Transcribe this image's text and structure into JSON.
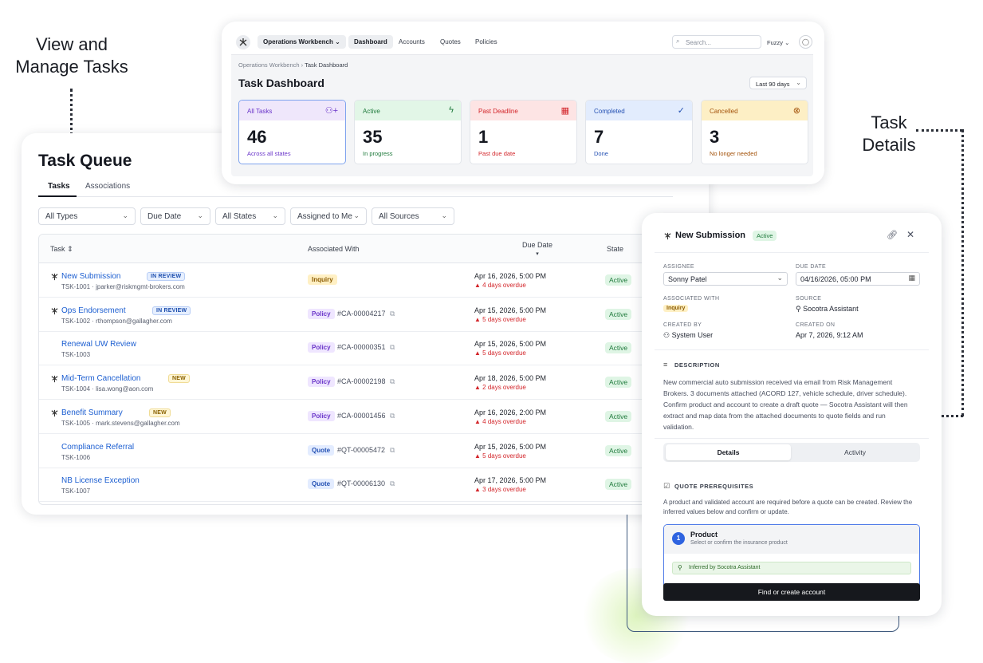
{
  "callouts": {
    "left_line1": "View and",
    "left_line2": "Manage Tasks",
    "right_line1": "Task",
    "right_line2": "Details"
  },
  "dashboard": {
    "nav": {
      "workbench": "Operations Workbench",
      "tabs": [
        "Dashboard",
        "Accounts",
        "Quotes",
        "Policies"
      ],
      "search_placeholder": "Search...",
      "user": "Fuzzy"
    },
    "breadcrumb": {
      "parent": "Operations Workbench",
      "separator": "›",
      "current": "Task Dashboard"
    },
    "title": "Task Dashboard",
    "range": "Last 90 days",
    "stats": [
      {
        "label": "All Tasks",
        "value": "46",
        "sub": "Across all states",
        "icon": "add-user-icon",
        "color": "#6a35c9",
        "bg": "#efe7fb"
      },
      {
        "label": "Active",
        "value": "35",
        "sub": "In progress",
        "icon": "lightning-icon",
        "color": "#1f7a3c",
        "bg": "#e2f6e7"
      },
      {
        "label": "Past Deadline",
        "value": "1",
        "sub": "Past due date",
        "icon": "calendar-icon",
        "color": "#d3262b",
        "bg": "#fde4e4"
      },
      {
        "label": "Completed",
        "value": "7",
        "sub": "Done",
        "icon": "check-circle-icon",
        "color": "#2451b3",
        "bg": "#e2ecfd"
      },
      {
        "label": "Cancelled",
        "value": "3",
        "sub": "No longer needed",
        "icon": "x-circle-icon",
        "color": "#a3520a",
        "bg": "#fdefc5"
      }
    ]
  },
  "queue": {
    "title": "Task Queue",
    "tabs": [
      "Tasks",
      "Associations"
    ],
    "filters": [
      "All Types",
      "Due Date",
      "All States",
      "Assigned to Me",
      "All Sources"
    ],
    "columns": {
      "task": "Task",
      "associated": "Associated With",
      "due": "Due Date",
      "state": "State"
    },
    "rows": [
      {
        "name": "New Submission",
        "sub": "TSK-1001 · jparker@riskmgmt-brokers.com",
        "badge": "IN REVIEW",
        "badge_type": "review",
        "chip": "Inquiry",
        "chip_type": "inquiry",
        "ref": "",
        "due": "Apr 16, 2026, 5:00 PM",
        "overdue": "▲ 4 days overdue",
        "state": "Active",
        "icon": true
      },
      {
        "name": "Ops Endorsement",
        "sub": "TSK-1002 · rthompson@gallagher.com",
        "badge": "IN REVIEW",
        "badge_type": "review",
        "chip": "Policy",
        "chip_type": "policy",
        "ref": "#CA-00004217",
        "due": "Apr 15, 2026, 5:00 PM",
        "overdue": "▲ 5 days overdue",
        "state": "Active",
        "icon": true
      },
      {
        "name": "Renewal UW Review",
        "sub": "TSK-1003",
        "badge": "",
        "badge_type": "",
        "chip": "Policy",
        "chip_type": "policy",
        "ref": "#CA-00000351",
        "due": "Apr 15, 2026, 5:00 PM",
        "overdue": "▲ 5 days overdue",
        "state": "Active",
        "icon": false
      },
      {
        "name": "Mid-Term Cancellation",
        "sub": "TSK-1004 · lisa.wong@aon.com",
        "badge": "NEW",
        "badge_type": "new",
        "chip": "Policy",
        "chip_type": "policy",
        "ref": "#CA-00002198",
        "due": "Apr 18, 2026, 5:00 PM",
        "overdue": "▲ 2 days overdue",
        "state": "Active",
        "icon": true
      },
      {
        "name": "Benefit Summary",
        "sub": "TSK-1005 · mark.stevens@gallagher.com",
        "badge": "NEW",
        "badge_type": "new",
        "chip": "Policy",
        "chip_type": "policy",
        "ref": "#CA-00001456",
        "due": "Apr 16, 2026, 2:00 PM",
        "overdue": "▲ 4 days overdue",
        "state": "Active",
        "icon": true
      },
      {
        "name": "Compliance Referral",
        "sub": "TSK-1006",
        "badge": "",
        "badge_type": "",
        "chip": "Quote",
        "chip_type": "quote",
        "ref": "#QT-00005472",
        "due": "Apr 15, 2026, 5:00 PM",
        "overdue": "▲ 5 days overdue",
        "state": "Active",
        "icon": false
      },
      {
        "name": "NB License Exception",
        "sub": "TSK-1007",
        "badge": "",
        "badge_type": "",
        "chip": "Quote",
        "chip_type": "quote",
        "ref": "#QT-00006130",
        "due": "Apr 17, 2026, 5:00 PM",
        "overdue": "▲ 3 days overdue",
        "state": "Active",
        "icon": false
      }
    ]
  },
  "detail": {
    "title": "New Submission",
    "status": "Active",
    "assignee_label": "ASSIGNEE",
    "assignee": "Sonny Patel",
    "due_label": "DUE DATE",
    "due": "04/16/2026, 05:00 PM",
    "assoc_label": "ASSOCIATED WITH",
    "assoc": "Inquiry",
    "source_label": "SOURCE",
    "source": "Socotra Assistant",
    "created_by_label": "CREATED BY",
    "created_by": "System User",
    "created_on_label": "CREATED ON",
    "created_on": "Apr 7, 2026, 9:12 AM",
    "description_label": "DESCRIPTION",
    "description": "New commercial auto submission received via email from Risk Management Brokers. 3 documents attached (ACORD 127, vehicle schedule, driver schedule). Confirm product and account to create a draft quote — Socotra Assistant will then extract and map data from the attached documents to quote fields and run validation.",
    "tabs": [
      "Details",
      "Activity"
    ],
    "prereq_label": "QUOTE PREREQUISITES",
    "prereq_text": "A product and validated account are required before a quote can be created. Review the inferred values below and confirm or update.",
    "step": "1",
    "product_title": "Product",
    "product_sub": "Select or confirm the insurance product",
    "inferred": "Inferred by Socotra Assistant",
    "cta": "Find or create account"
  }
}
